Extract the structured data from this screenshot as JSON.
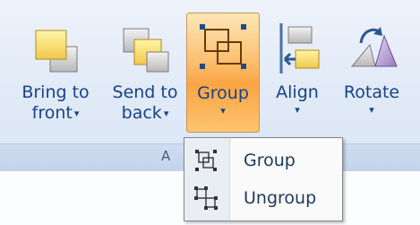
{
  "ribbon": {
    "group_label": "A",
    "buttons": [
      {
        "line1": "Bring to",
        "line2": "front",
        "icon": "bring-to-front-icon"
      },
      {
        "line1": "Send to",
        "line2": "back",
        "icon": "send-to-back-icon"
      },
      {
        "line1": "Group",
        "line2": "",
        "icon": "group-icon"
      },
      {
        "line1": "Align",
        "line2": "",
        "icon": "align-icon"
      },
      {
        "line1": "Rotate",
        "line2": "",
        "icon": "rotate-icon"
      }
    ],
    "caret": "▾"
  },
  "group_menu": {
    "items": [
      {
        "label": "Group",
        "icon": "group-objects-icon"
      },
      {
        "label": "Ungroup",
        "icon": "ungroup-objects-icon"
      }
    ]
  },
  "colors": {
    "active_button": "#fba444",
    "label_text": "#15428b",
    "menu_border": "#868686"
  }
}
